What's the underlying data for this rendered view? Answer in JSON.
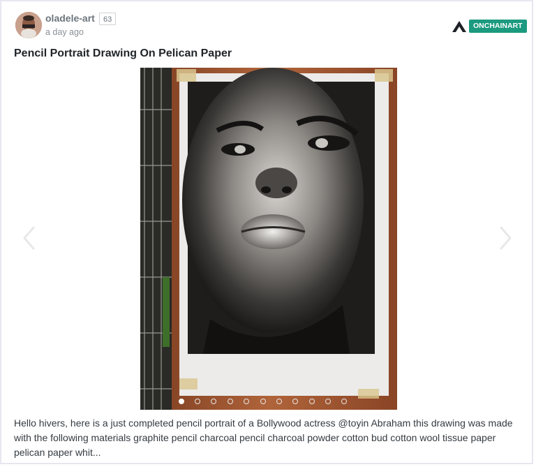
{
  "author": {
    "name": "oladele-art",
    "reputation": "63",
    "avatar_icon": "user-avatar"
  },
  "post": {
    "timestamp": "a day ago",
    "title": "Pencil Portrait Drawing On Pelican Paper",
    "summary": "Hello hivers, here is a just completed pencil portrait of a Bollywood actress @toyin Abraham this drawing was made with the following materials graphite pencil charcoal pencil charcoal powder cotton bud cotton wool tissue paper pelican paper whit..."
  },
  "community": {
    "label": "ONCHAINART",
    "logo_icon": "community-logo-icon",
    "badge_color": "#1b9a7f"
  },
  "carousel": {
    "image_description_icon": "portrait-drawing-image",
    "slide_count": 11,
    "active_slide": 1,
    "prev_icon": "chevron-left-icon",
    "next_icon": "chevron-right-icon"
  },
  "colors": {
    "username": "#6c757d",
    "title": "#212529",
    "border": "#e7e7f1"
  }
}
